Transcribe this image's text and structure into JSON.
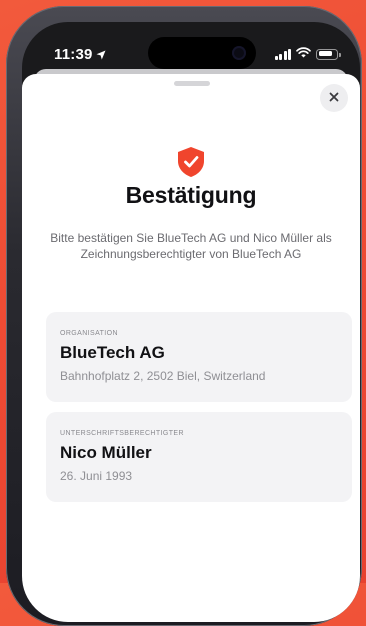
{
  "status_bar": {
    "time": "11:39",
    "battery_level": 0.8
  },
  "sheet": {
    "title": "Bestätigung",
    "description": "Bitte bestätigen Sie BlueTech AG und Nico Müller als Zeichnungsberechtigter von BlueTech AG",
    "close_icon": "close-icon",
    "shield_icon": "shield-check-icon",
    "accent_color": "#f0452d"
  },
  "organisation": {
    "label": "ORGANISATION",
    "name": "BlueTech AG",
    "address": "Bahnhofplatz 2, 2502 Biel, Switzerland"
  },
  "signatory": {
    "label": "UNTERSCHRIFTSBERECHTIGTER",
    "name": "Nico Müller",
    "birthdate": "26. Juni 1993"
  }
}
